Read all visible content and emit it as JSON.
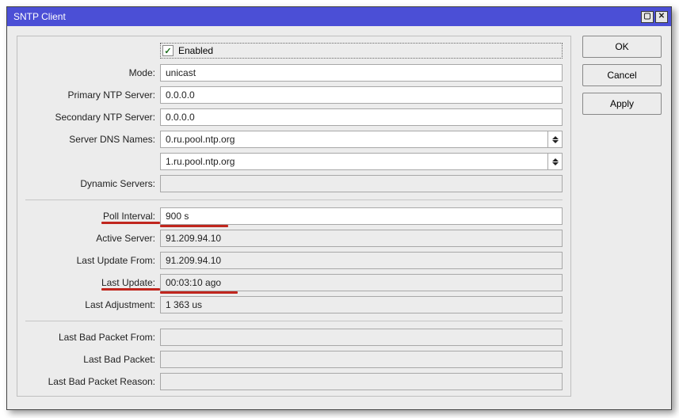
{
  "window": {
    "title": "SNTP Client"
  },
  "buttons": {
    "ok": "OK",
    "cancel": "Cancel",
    "apply": "Apply"
  },
  "labels": {
    "mode": "Mode:",
    "primary_ntp": "Primary NTP Server:",
    "secondary_ntp": "Secondary NTP Server:",
    "server_dns": "Server DNS Names:",
    "dynamic_servers": "Dynamic Servers:",
    "poll_interval": "Poll Interval:",
    "active_server": "Active Server:",
    "last_update_from": "Last Update From:",
    "last_update": "Last Update:",
    "last_adjustment": "Last Adjustment:",
    "last_bad_from": "Last Bad Packet From:",
    "last_bad": "Last Bad Packet:",
    "last_bad_reason": "Last Bad Packet Reason:"
  },
  "fields": {
    "enabled": true,
    "enabled_label": "Enabled",
    "mode": "unicast",
    "primary_ntp": "0.0.0.0",
    "secondary_ntp": "0.0.0.0",
    "dns1": "0.ru.pool.ntp.org",
    "dns2": "1.ru.pool.ntp.org",
    "dynamic_servers": "",
    "poll_interval": "900 s",
    "active_server": "91.209.94.10",
    "last_update_from": "91.209.94.10",
    "last_update": "00:03:10 ago",
    "last_adjustment": "1 363 us",
    "last_bad_from": "",
    "last_bad": "",
    "last_bad_reason": ""
  }
}
